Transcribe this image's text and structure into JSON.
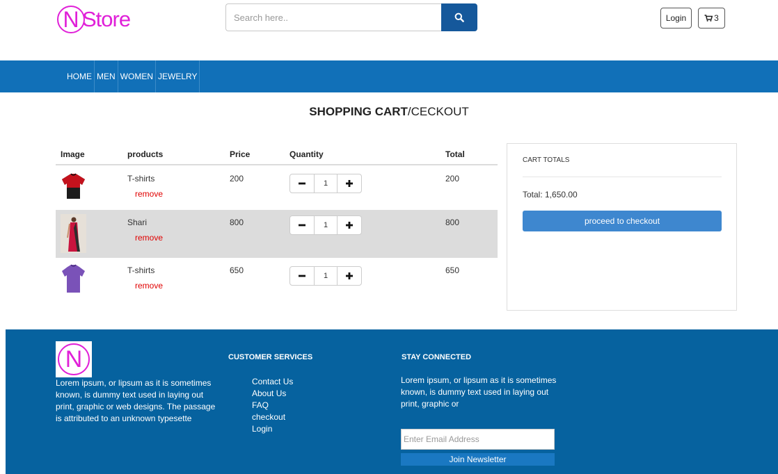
{
  "header": {
    "logo_letter": "N",
    "logo_text": "Store",
    "search_placeholder": "Search here..",
    "login_label": "Login",
    "cart_count": "3"
  },
  "nav": {
    "items": [
      {
        "label": "HOME"
      },
      {
        "label": "MEN"
      },
      {
        "label": "WOMEN"
      },
      {
        "label": "JEWELRY"
      }
    ]
  },
  "page_title": {
    "bold": "SHOPPING CART",
    "rest": "/CECKOUT"
  },
  "cart": {
    "columns": {
      "image": "Image",
      "products": "products",
      "price": "Price",
      "quantity": "Quantity",
      "total": "Total"
    },
    "rows": [
      {
        "product": "T-shirts",
        "remove": "remove",
        "price": "200",
        "qty": "1",
        "total": "200",
        "image": "red-black-tshirt"
      },
      {
        "product": "Shari",
        "remove": "remove",
        "price": "800",
        "qty": "1",
        "total": "800",
        "image": "red-saree"
      },
      {
        "product": "T-shirts",
        "remove": "remove",
        "price": "650",
        "qty": "1",
        "total": "650",
        "image": "purple-tshirt"
      }
    ]
  },
  "totals": {
    "heading": "CART TOTALS",
    "total": "Total: 1,650.00",
    "checkout_label": "proceed to checkout"
  },
  "footer": {
    "logo_letter": "N",
    "about": "Lorem ipsum, or lipsum as it is sometimes known, is dummy text used in laying out print, graphic or web designs. The passage is attributed to an unknown typesette",
    "services_heading": "CUSTOMER SERVICES",
    "links": [
      {
        "label": "Contact Us"
      },
      {
        "label": "About Us"
      },
      {
        "label": "FAQ"
      },
      {
        "label": "checkout"
      },
      {
        "label": "Login"
      }
    ],
    "connect_heading": "STAY CONNECTED",
    "connect_text": "Lorem ipsum, or lipsum as it is sometimes known, is dummy text used in laying out print, graphic or",
    "email_placeholder": "Enter Email Address",
    "join_label": "Join Newsletter"
  },
  "colors": {
    "brand": "#e020d8",
    "nav": "#1170b8",
    "footer": "#06629f",
    "search_button": "#15589b",
    "checkout_button": "#3e87cf",
    "remove": "#e00000"
  }
}
